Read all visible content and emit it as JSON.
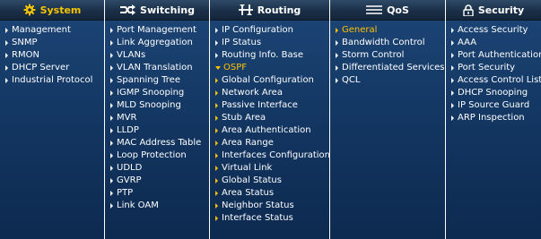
{
  "colors": {
    "header_bg": "#1a2f47",
    "panel_bg": "#123560",
    "text": "#ffffff",
    "highlight": "#ffc000"
  },
  "columns": [
    {
      "title": "System",
      "icon": "gear-icon",
      "items": [
        "Management",
        "SNMP",
        "RMON",
        "DHCP Server",
        "Industrial Protocol"
      ]
    },
    {
      "title": "Switching",
      "icon": "switching-arrows-icon",
      "items": [
        "Port Management",
        "Link Aggregation",
        "VLANs",
        "VLAN Translation",
        "Spanning Tree",
        "IGMP Snooping",
        "MLD Snooping",
        "MVR",
        "LLDP",
        "MAC Address Table",
        "Loop Protection",
        "UDLD",
        "GVRP",
        "PTP",
        "Link OAM"
      ]
    },
    {
      "title": "Routing",
      "icon": "routing-arrows-icon",
      "items": [
        "IP Configuration",
        "IP Status",
        "Routing Info. Base"
      ],
      "expanded": "OSPF",
      "subitems": [
        "Global Configuration",
        "Network Area",
        "Passive Interface",
        "Stub Area",
        "Area Authentication",
        "Area Range",
        "Interfaces Configuration",
        "Virtual Link",
        "Global Status",
        "Area Status",
        "Neighbor Status",
        "Interface Status"
      ]
    },
    {
      "title": "QoS",
      "icon": "qos-lines-icon",
      "items": [
        "General",
        "Bandwidth Control",
        "Storm Control",
        "Differentiated Services",
        "QCL"
      ],
      "active": "General"
    },
    {
      "title": "Security",
      "icon": "lock-icon",
      "items": [
        "Access Security",
        "AAA",
        "Port Authentication",
        "Port Security",
        "Access Control List",
        "DHCP Snooping",
        "IP Source Guard",
        "ARP Inspection"
      ]
    }
  ]
}
